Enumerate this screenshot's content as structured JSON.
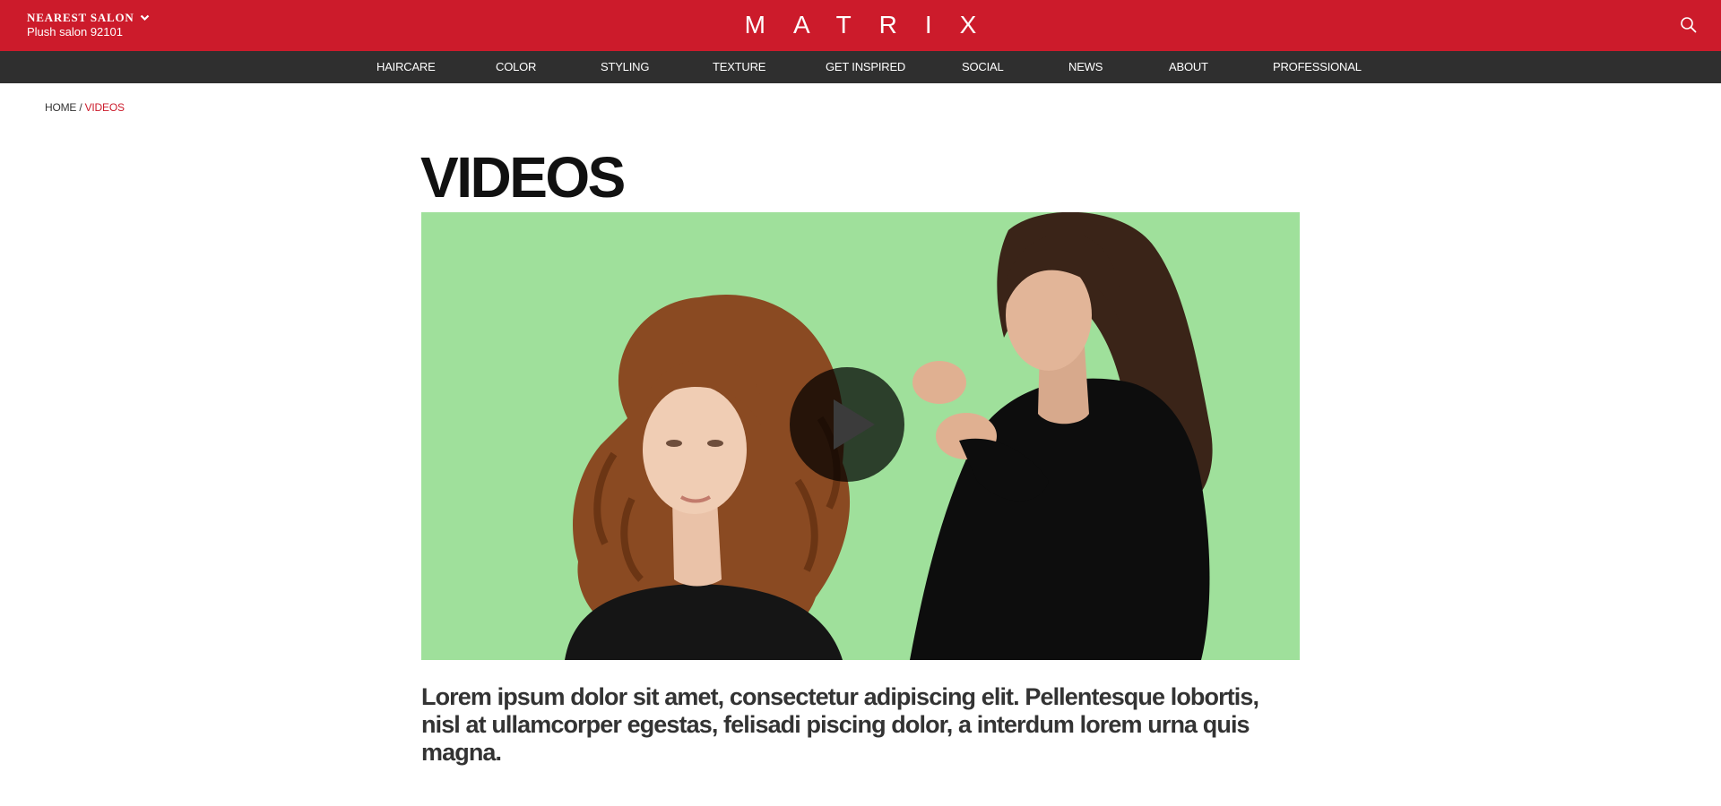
{
  "header": {
    "salon_title": "NEAREST SALON",
    "salon_name": "Plush salon 92101",
    "logo_text": "MATRIX",
    "search_icon": "search-icon",
    "dropdown_icon": "chevron-down-icon"
  },
  "nav": {
    "items": [
      {
        "label": "HAIRCARE"
      },
      {
        "label": "COLOR"
      },
      {
        "label": "STYLING"
      },
      {
        "label": "TEXTURE"
      },
      {
        "label": "GET INSPIRED"
      },
      {
        "label": "SOCIAL"
      },
      {
        "label": "NEWS"
      },
      {
        "label": "ABOUT"
      },
      {
        "label": "PROFESSIONAL"
      }
    ]
  },
  "breadcrumb": {
    "home": "HOME",
    "separator": " / ",
    "current": "VIDEOS"
  },
  "page": {
    "title": "VIDEOS",
    "description": "Lorem ipsum dolor sit amet, consectetur adipiscing elit. Pellentesque lobortis, nisl at ullamcorper egestas, felisadi piscing dolor, a interdum lorem urna quis magna."
  },
  "video": {
    "play_icon": "play-icon"
  },
  "colors": {
    "brand_red": "#cc1b2b",
    "nav_dark": "#2f2f2f",
    "video_background": "#9fe09b"
  }
}
